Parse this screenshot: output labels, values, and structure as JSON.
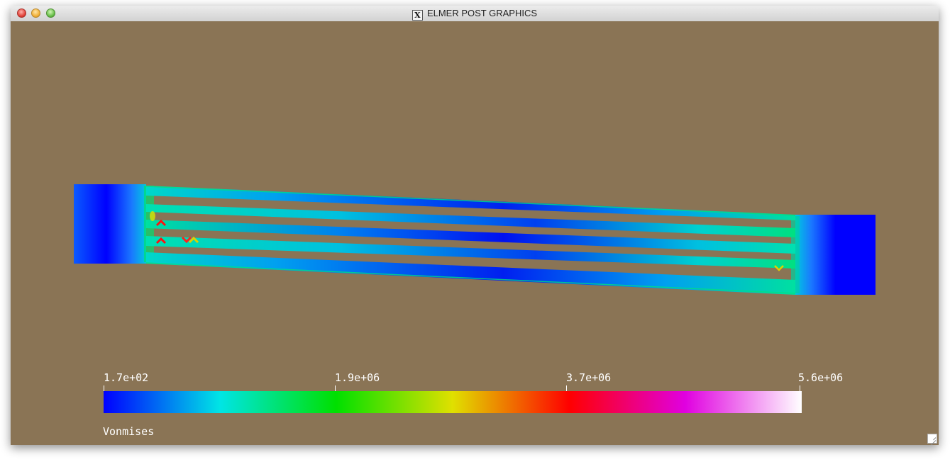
{
  "window": {
    "title": "ELMER POST GRAPHICS",
    "title_icon": "x11-icon",
    "controls": [
      "close",
      "minimize",
      "zoom"
    ]
  },
  "colors": {
    "background": "#8a7455",
    "scale": [
      "#0000ff",
      "#00e5e5",
      "#00e000",
      "#e0e000",
      "#ff0000",
      "#e000e0",
      "#ffffff"
    ]
  },
  "colorbar": {
    "variable": "Vonmises",
    "ticks": [
      "1.7e+02",
      "1.9e+06",
      "3.7e+06",
      "5.6e+06"
    ]
  }
}
